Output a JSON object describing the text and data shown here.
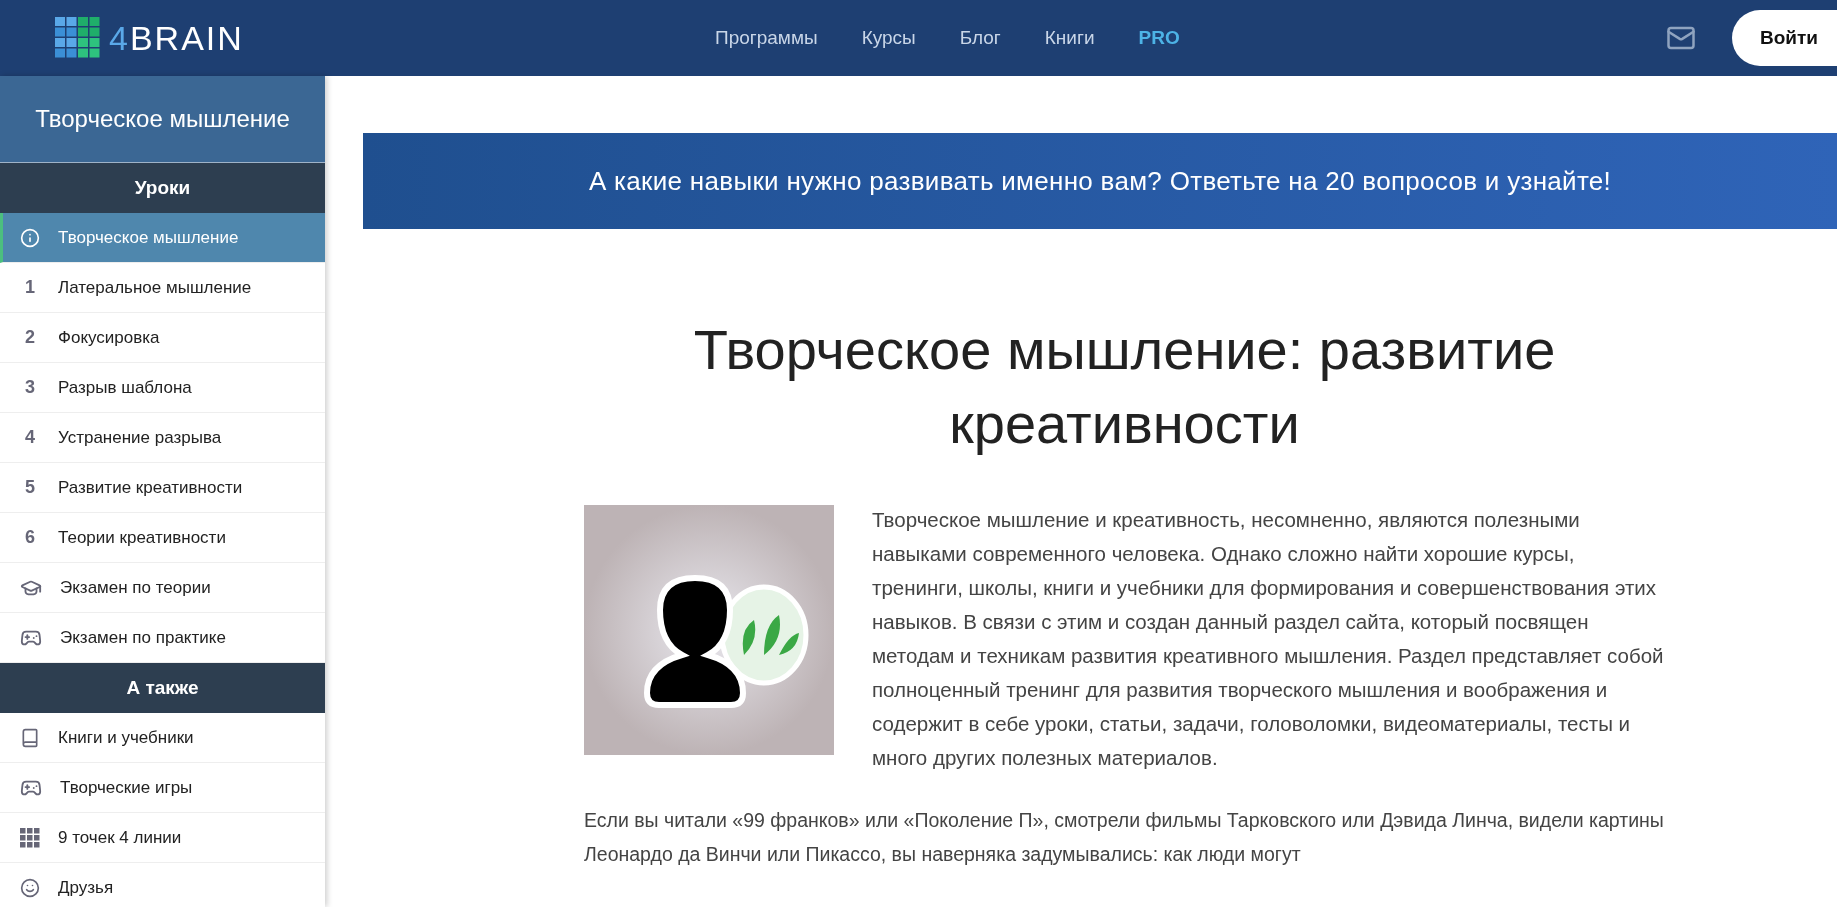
{
  "header": {
    "logo": {
      "number": "4",
      "word": "BRAIN"
    },
    "nav": [
      {
        "label": "Программы",
        "highlighted": false
      },
      {
        "label": "Курсы",
        "highlighted": false
      },
      {
        "label": "Блог",
        "highlighted": false
      },
      {
        "label": "Книги",
        "highlighted": false
      },
      {
        "label": "PRO",
        "highlighted": true
      }
    ],
    "login_button": "Войти"
  },
  "sidebar": {
    "title": "Творческое мышление",
    "sections": [
      {
        "heading": "Уроки",
        "items": [
          {
            "kind": "info",
            "label": "Творческое мышление",
            "selected": true
          },
          {
            "kind": "number",
            "number": "1",
            "label": "Латеральное мышление",
            "selected": false
          },
          {
            "kind": "number",
            "number": "2",
            "label": "Фокусировка",
            "selected": false
          },
          {
            "kind": "number",
            "number": "3",
            "label": "Разрыв шаблона",
            "selected": false
          },
          {
            "kind": "number",
            "number": "4",
            "label": "Устранение разрыва",
            "selected": false
          },
          {
            "kind": "number",
            "number": "5",
            "label": "Развитие креативности",
            "selected": false
          },
          {
            "kind": "number",
            "number": "6",
            "label": "Теории креативности",
            "selected": false
          },
          {
            "kind": "cap",
            "label": "Экзамен по теории",
            "selected": false
          },
          {
            "kind": "gamepad",
            "label": "Экзамен по практике",
            "selected": false
          }
        ]
      },
      {
        "heading": "А также",
        "items": [
          {
            "kind": "book",
            "label": "Книги и учебники",
            "selected": false
          },
          {
            "kind": "gamepad",
            "label": "Творческие игры",
            "selected": false
          },
          {
            "kind": "grid",
            "label": "9 точек 4 линии",
            "selected": false
          },
          {
            "kind": "smile",
            "label": "Друзья",
            "selected": false
          }
        ]
      }
    ]
  },
  "banner": "А какие навыки нужно развивать именно вам? Ответьте на 20 вопросов и узнайте!",
  "article": {
    "title": "Творческое мышление: развитие креативности",
    "paragraphs": [
      "Творческое мышление и креативность, несомненно, являются полезными навыками современного человека. Однако сложно найти хорошие курсы, тренинги, школы, книги и учебники для формирования и совершенствования этих навыков. В связи с этим и создан данный раздел сайта, который посвящен методам и техникам развития креативного мышления. Раздел представляет собой полноценный тренинг для развития творческого мышления и воображения и содержит в себе уроки, статьи, задачи, головоломки, видеоматериалы, тесты и много других полезных материалов.",
      "Если вы читали «99 франков» или «Поколение П», смотрели фильмы Тарковского или Дэвида Линча, видели картины Леонардо да Винчи или Пикассо, вы наверняка задумывались: как люди могут"
    ]
  }
}
